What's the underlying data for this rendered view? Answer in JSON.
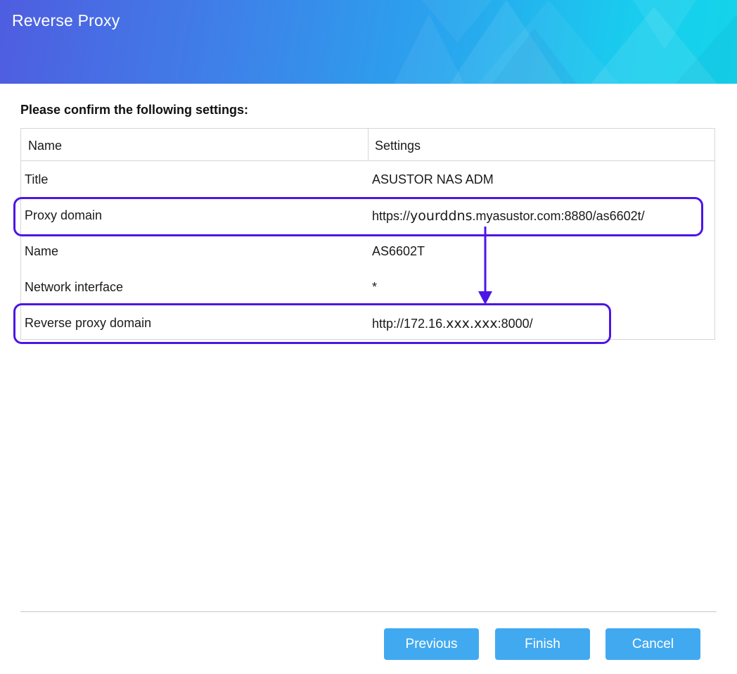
{
  "window": {
    "title": "Reverse Proxy"
  },
  "heading": "Please confirm the following settings:",
  "table": {
    "columns": [
      "Name",
      "Settings"
    ],
    "rows": [
      {
        "name": "Title",
        "setting": "ASUSTOR NAS ADM"
      },
      {
        "name": "Proxy domain",
        "setting_prefix": "https://",
        "setting_masked": "yourddns",
        "setting_suffix": ".myasustor.com:8880/as6602t/"
      },
      {
        "name": "Name",
        "setting": "AS6602T"
      },
      {
        "name": "Network interface",
        "setting": "*"
      },
      {
        "name": "Reverse proxy domain",
        "setting_prefix": "http://172.16.",
        "setting_masked": "xxx.xxx",
        "setting_suffix": ":8000/"
      }
    ]
  },
  "annotation": {
    "highlight_color": "#4b16e6"
  },
  "buttons": {
    "previous": "Previous",
    "finish": "Finish",
    "cancel": "Cancel"
  },
  "colors": {
    "button": "#41a9f0",
    "accent": "#4b16e6"
  }
}
